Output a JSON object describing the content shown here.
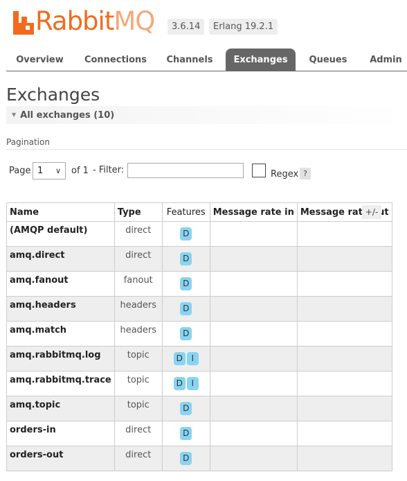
{
  "header": {
    "logo_rabbit": "Rabbit",
    "logo_mq": "MQ",
    "version": "3.6.14",
    "erlang": "Erlang 19.2.1"
  },
  "tabs": [
    "Overview",
    "Connections",
    "Channels",
    "Exchanges",
    "Queues",
    "Admin"
  ],
  "active_tab": "Exchanges",
  "page_title": "Exchanges",
  "section_title": "All exchanges (10)",
  "pagination": {
    "label": "Pagination",
    "page_label": "Page",
    "page_value": "1",
    "of_label": "of 1",
    "filter_label": "- Filter:",
    "filter_value": "",
    "regex_label": "Regex",
    "help": "?"
  },
  "table": {
    "columns": [
      "Name",
      "Type",
      "Features",
      "Message rate in",
      "Message rate out"
    ],
    "toggle_columns": "+/-",
    "rows": [
      {
        "name": "(AMQP default)",
        "type": "direct",
        "features": [
          "D"
        ],
        "rate_in": "",
        "rate_out": ""
      },
      {
        "name": "amq.direct",
        "type": "direct",
        "features": [
          "D"
        ],
        "rate_in": "",
        "rate_out": ""
      },
      {
        "name": "amq.fanout",
        "type": "fanout",
        "features": [
          "D"
        ],
        "rate_in": "",
        "rate_out": ""
      },
      {
        "name": "amq.headers",
        "type": "headers",
        "features": [
          "D"
        ],
        "rate_in": "",
        "rate_out": ""
      },
      {
        "name": "amq.match",
        "type": "headers",
        "features": [
          "D"
        ],
        "rate_in": "",
        "rate_out": ""
      },
      {
        "name": "amq.rabbitmq.log",
        "type": "topic",
        "features": [
          "D",
          "I"
        ],
        "rate_in": "",
        "rate_out": ""
      },
      {
        "name": "amq.rabbitmq.trace",
        "type": "topic",
        "features": [
          "D",
          "I"
        ],
        "rate_in": "",
        "rate_out": ""
      },
      {
        "name": "amq.topic",
        "type": "topic",
        "features": [
          "D"
        ],
        "rate_in": "",
        "rate_out": ""
      },
      {
        "name": "orders-in",
        "type": "direct",
        "features": [
          "D"
        ],
        "rate_in": "",
        "rate_out": ""
      },
      {
        "name": "orders-out",
        "type": "direct",
        "features": [
          "D"
        ],
        "rate_in": "",
        "rate_out": ""
      }
    ]
  },
  "colors": {
    "brand_orange": "#f26b1d",
    "active_tab": "#666666",
    "feature_tag": "#88d4f2",
    "row_alt": "#eeeeee"
  }
}
